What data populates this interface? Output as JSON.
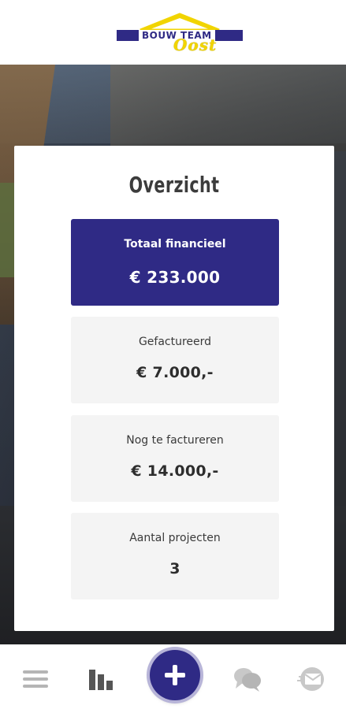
{
  "header": {
    "logo_main": "BOUW TEAM",
    "logo_script": "Oost"
  },
  "overview": {
    "title": "Overzicht",
    "stats": [
      {
        "label": "Totaal financieel",
        "value": "€ 233.000"
      },
      {
        "label": "Gefactureerd",
        "value": "€ 7.000,-"
      },
      {
        "label": "Nog te factureren",
        "value": "€ 14.000,-"
      },
      {
        "label": "Aantal projecten",
        "value": "3"
      }
    ]
  },
  "nav": {
    "icons": [
      "menu-icon",
      "bar-chart-icon",
      "plus-icon",
      "chat-icon",
      "mail-icon"
    ]
  },
  "colors": {
    "brand_primary": "#2f2a85",
    "brand_yellow": "#f1d400",
    "card_background": "#f4f4f4",
    "icon_gray": "#b5b5b5",
    "icon_dark": "#555555"
  }
}
